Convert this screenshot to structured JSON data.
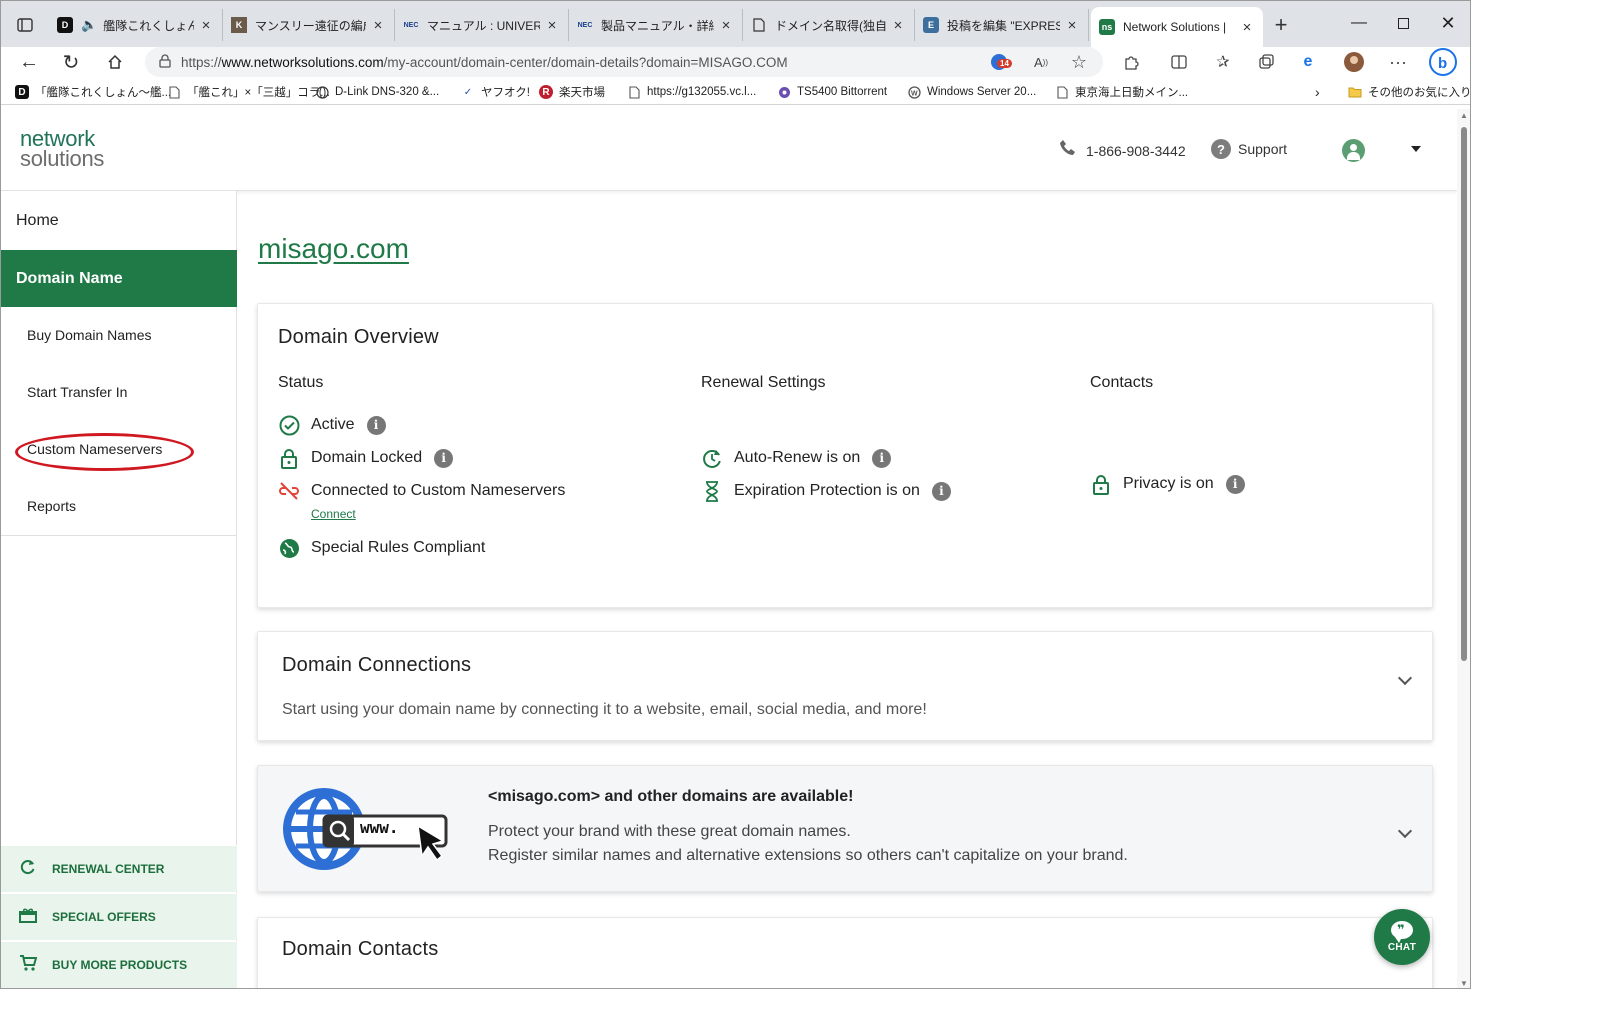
{
  "browser": {
    "tabs": [
      {
        "title": "艦隊これくしょん -艦",
        "icon": "D"
      },
      {
        "title": "マンスリー遠征の編成",
        "icon": "K"
      },
      {
        "title": "マニュアル : UNIVERGE",
        "icon": "NEC"
      },
      {
        "title": "製品マニュアル・詳細",
        "icon": "NEC"
      },
      {
        "title": "ドメイン名取得(独自ド",
        "icon": "doc"
      },
      {
        "title": "投稿を編集 \"EXPRESS",
        "icon": "E"
      },
      {
        "title": "Network Solutions |",
        "icon": "ns"
      }
    ],
    "url_prefix": "https://",
    "url_domain": "www.networksolutions.com",
    "url_path": "/my-account/domain-center/domain-details?domain=MISAGO.COM",
    "badge": "14",
    "bookmarks": [
      {
        "label": "「艦隊これくしょん～艦...",
        "icon": "D"
      },
      {
        "label": "「艦これ」×「三越」コラ...",
        "icon": "page"
      },
      {
        "label": "D-Link DNS-320 &...",
        "icon": "globe"
      },
      {
        "label": "ヤフオク!",
        "icon": "Y"
      },
      {
        "label": "楽天市場",
        "icon": "R"
      },
      {
        "label": "https://g132055.vc.l...",
        "icon": "page"
      },
      {
        "label": "TS5400 Bittorrent",
        "icon": "ts"
      },
      {
        "label": "Windows Server 20...",
        "icon": "wp"
      },
      {
        "label": "東京海上日動メイン...",
        "icon": "page"
      }
    ],
    "other_favorites": "その他のお気に入り"
  },
  "header": {
    "logo_line1": "network",
    "logo_line2": "solutions",
    "phone": "1-866-908-3442",
    "support": "Support"
  },
  "sidebar": {
    "home": "Home",
    "active": "Domain Name",
    "items": [
      "Buy Domain Names",
      "Start Transfer In",
      "Custom Nameservers",
      "Reports"
    ],
    "bottom": [
      "RENEWAL CENTER",
      "SPECIAL OFFERS",
      "BUY MORE PRODUCTS"
    ]
  },
  "main": {
    "domain": "misago.com",
    "overview": {
      "title": "Domain Overview",
      "status_title": "Status",
      "renewal_title": "Renewal Settings",
      "contacts_title": "Contacts",
      "status": [
        "Active",
        "Domain Locked",
        "Connected to Custom Nameservers",
        "Special Rules Compliant"
      ],
      "connect": "Connect",
      "renewal": [
        "Auto-Renew is on",
        "Expiration Protection is on"
      ],
      "contacts": [
        "Privacy is on"
      ]
    },
    "connections": {
      "title": "Domain Connections",
      "desc": "Start using your domain name by connecting it to a website, email, social media, and more!"
    },
    "promo": {
      "graphic_text": "www.",
      "title": "<misago.com> and other domains are available!",
      "line1": "Protect your brand with these great domain names.",
      "line2": "Register similar names and alternative extensions so others can't capitalize on your brand."
    },
    "contacts": {
      "title": "Domain Contacts"
    },
    "chat": "CHAT"
  },
  "colors": {
    "brand_green": "#1f7a47",
    "annotation_red": "#d01820",
    "link_green": "#1f7a47"
  }
}
